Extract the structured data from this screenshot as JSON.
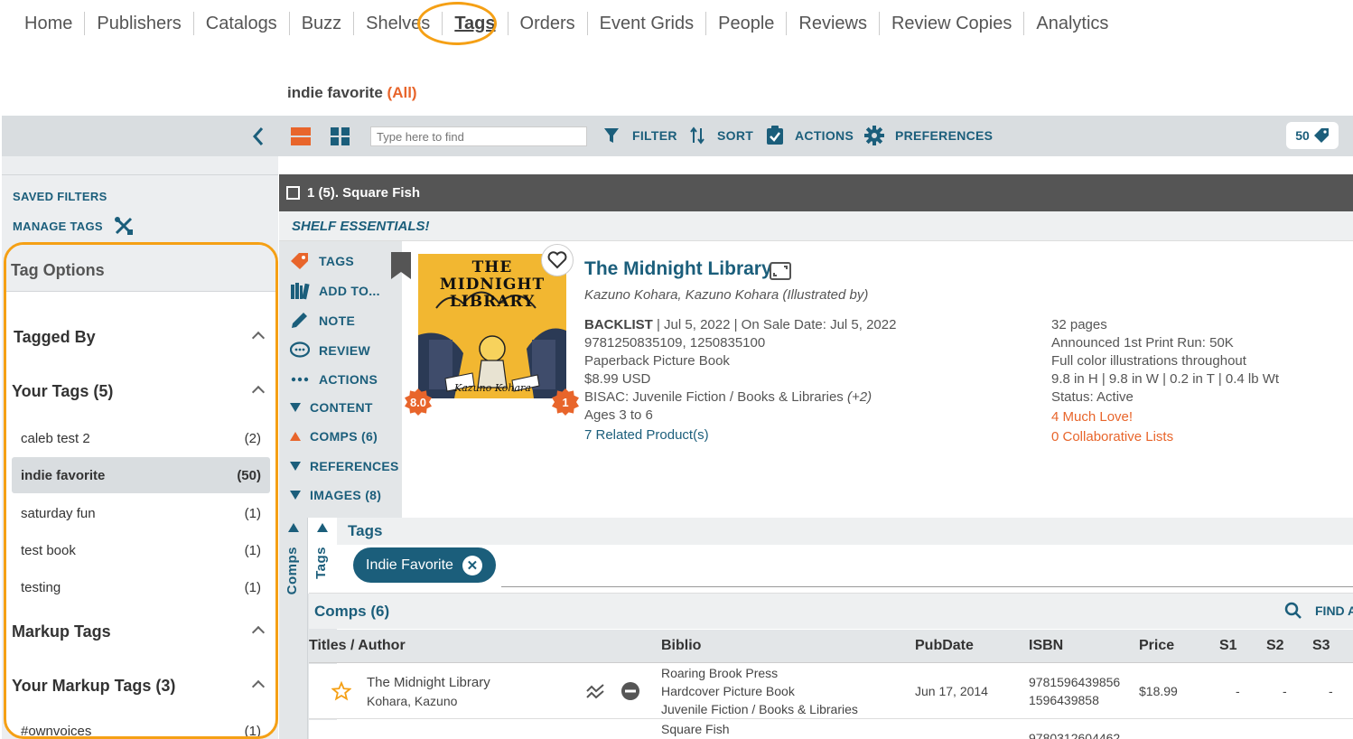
{
  "nav": {
    "items": [
      "Home",
      "Publishers",
      "Catalogs",
      "Buzz",
      "Shelves",
      "Tags",
      "Orders",
      "Event Grids",
      "People",
      "Reviews",
      "Review Copies",
      "Analytics"
    ],
    "active": "Tags"
  },
  "page": {
    "tag_name": "indie favorite",
    "all_link": "(All)"
  },
  "toolbar": {
    "search_placeholder": "Type here to find",
    "filter": "FILTER",
    "sort": "SORT",
    "actions": "ACTIONS",
    "preferences": "PREFERENCES",
    "count": "50"
  },
  "sidebar": {
    "saved_filters": "SAVED FILTERS",
    "manage_tags": "MANAGE TAGS",
    "tag_options": "Tag Options",
    "tagged_by": "Tagged By",
    "your_tags": "Your Tags (5)",
    "tags": [
      {
        "name": "caleb test 2",
        "count": "(2)"
      },
      {
        "name": "indie favorite",
        "count": "(50)"
      },
      {
        "name": "saturday fun",
        "count": "(1)"
      },
      {
        "name": "test book",
        "count": "(1)"
      },
      {
        "name": "testing",
        "count": "(1)"
      }
    ],
    "markup_tags": "Markup Tags",
    "your_markup_tags": "Your Markup Tags (3)",
    "markup_first": {
      "name": "#ownvoices",
      "count": "(1)"
    }
  },
  "group": {
    "label": "1 (5). Square Fish",
    "shelf": "SHELF ESSENTIALS!"
  },
  "actions": [
    "TAGS",
    "ADD TO...",
    "NOTE",
    "REVIEW",
    "ACTIONS",
    "CONTENT",
    "COMPS (6)",
    "REFERENCES",
    "IMAGES (8)"
  ],
  "book": {
    "title": "The Midnight Library",
    "author": "Kazuno Kohara, Kazuno Kohara (Illustrated by)",
    "cover_title": "THE MIDNIGHT LIBRARY",
    "cover_author": "Kazuno Kohara",
    "score": "8.0",
    "badge": "1",
    "status_label": "BACKLIST",
    "dates": " | Jul 5, 2022 | On Sale Date: Jul 5, 2022",
    "isbns": "9781250835109, 1250835100",
    "format": "Paperback Picture Book",
    "price": "$8.99 USD",
    "bisac": "BISAC: Juvenile Fiction / Books & Libraries",
    "bisac_more": "(+2)",
    "ages": "Ages 3 to 6",
    "related": "7 Related Product(s)",
    "pages": "32 pages",
    "print_run": "Announced 1st Print Run: 50K",
    "illustrations": "Full color illustrations throughout",
    "dimensions": "9.8 in H | 9.8 in W | 0.2 in T | 0.4 lb Wt",
    "status": "Status: Active",
    "much_love": "4 Much Love!",
    "collab": "0 Collaborative Lists"
  },
  "tags_panel": {
    "header": "Tags",
    "vertical_tags": "Tags",
    "vertical_comps": "Comps",
    "pill": "Indie Favorite"
  },
  "comps": {
    "header": "Comps (6)",
    "find": "FIND A",
    "columns": [
      "Titles / Author",
      "Biblio",
      "PubDate",
      "ISBN",
      "Price",
      "S1",
      "S2",
      "S3"
    ],
    "row1": {
      "title": "The Midnight Library",
      "author": "Kohara, Kazuno",
      "publisher": "Roaring Brook Press",
      "format": "Hardcover Picture Book",
      "category": "Juvenile Fiction / Books & Libraries",
      "pubdate": "Jun 17, 2014",
      "isbn13": "9781596439856",
      "isbn10": "1596439858",
      "price": "$18.99",
      "s1": "-",
      "s2": "-",
      "s3": "-"
    },
    "row2": {
      "publisher": "Square Fish",
      "isbn13": "9780312604462"
    }
  },
  "colors": {
    "accent": "#e8652b",
    "brand": "#1b5e7b",
    "highlight": "#f5a015"
  }
}
